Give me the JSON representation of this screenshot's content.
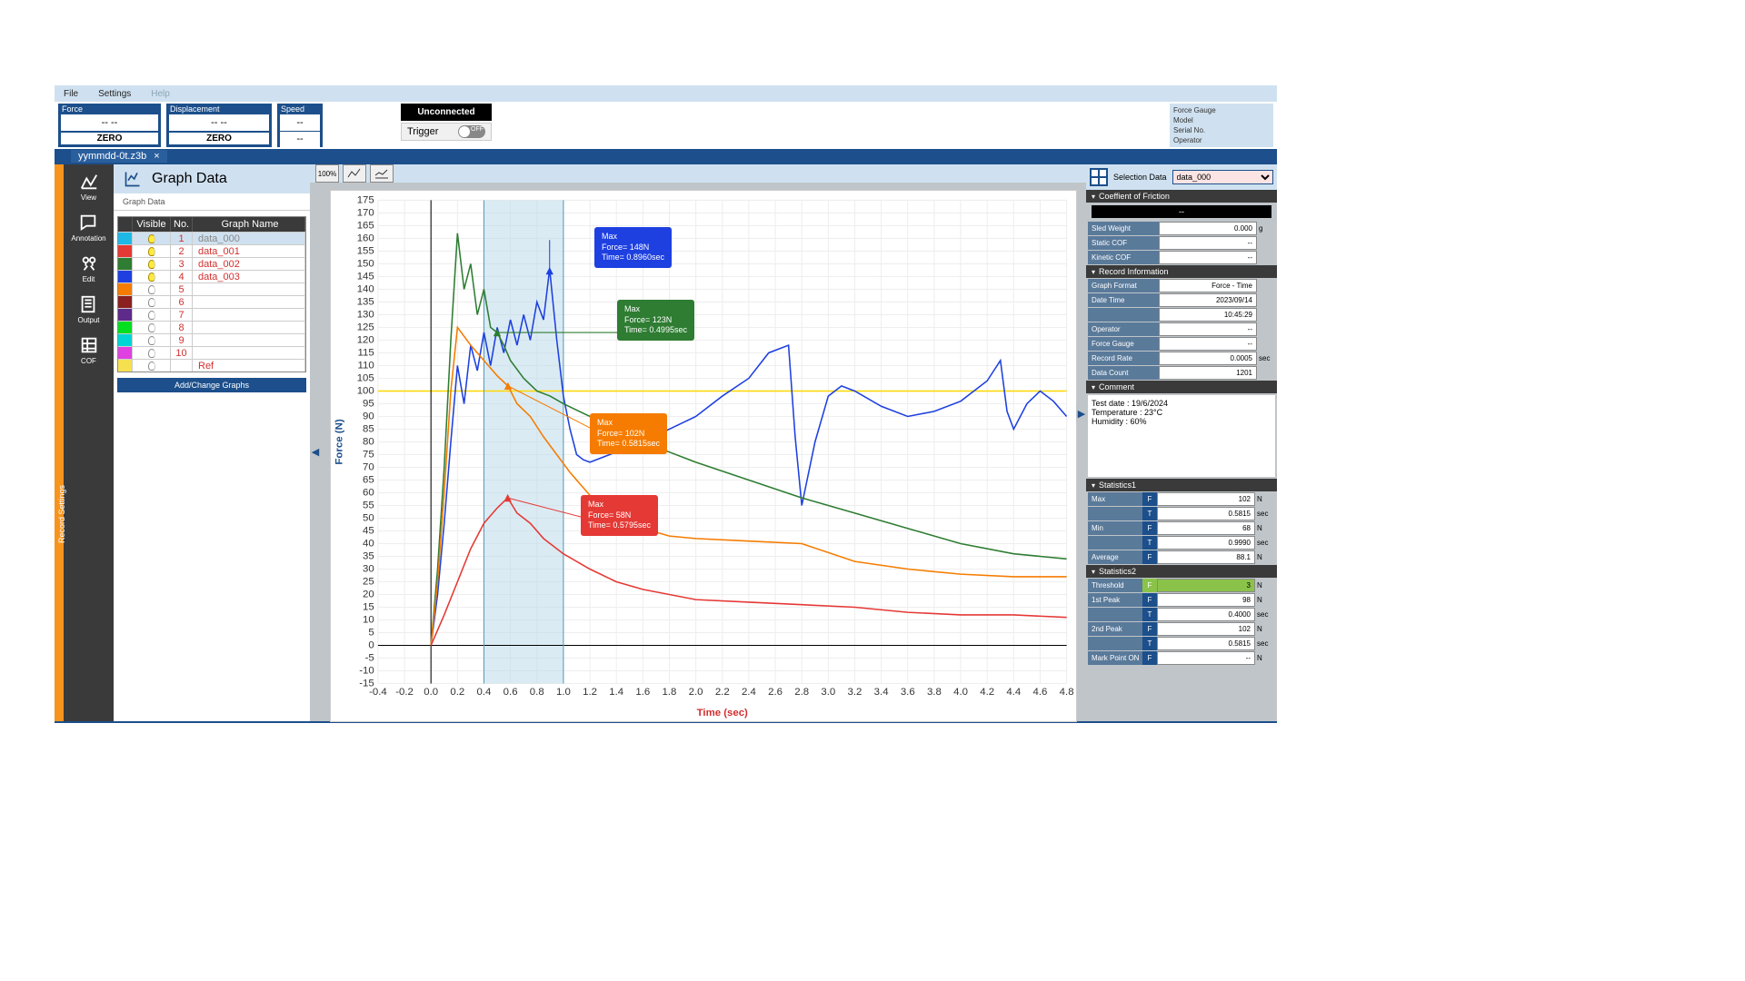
{
  "menu": {
    "file": "File",
    "settings": "Settings",
    "help": "Help"
  },
  "meters": {
    "force": {
      "title": "Force",
      "value": "-- --",
      "btn": "ZERO"
    },
    "disp": {
      "title": "Displacement",
      "value": "-- --",
      "btn": "ZERO"
    },
    "speed": {
      "title": "Speed",
      "value": "--",
      "value2": "--"
    }
  },
  "status": {
    "conn": "Unconnected",
    "trigger_label": "Trigger"
  },
  "device": {
    "a": "Force Gauge",
    "b": "Model",
    "c": "Serial No.",
    "d": "Operator"
  },
  "tab": {
    "name": "yymmdd-0t.z3b"
  },
  "orange_label": "Record Settings",
  "sidebar": [
    {
      "label": "View"
    },
    {
      "label": "Annotation"
    },
    {
      "label": "Edit"
    },
    {
      "label": "Output"
    },
    {
      "label": "COF"
    }
  ],
  "leftpanel": {
    "title": "Graph Data",
    "subtab": "Graph Data",
    "add": "Add/Change Graphs",
    "headers": {
      "vis": "Visible",
      "no": "No.",
      "name": "Graph Name"
    },
    "rows": [
      {
        "color": "#1EB8E6",
        "on": true,
        "no": "1",
        "name": "data_000",
        "sel": true
      },
      {
        "color": "#E53935",
        "on": true,
        "no": "2",
        "name": "data_001"
      },
      {
        "color": "#2E7D32",
        "on": true,
        "no": "3",
        "name": "data_002"
      },
      {
        "color": "#1E40E0",
        "on": true,
        "no": "4",
        "name": "data_003"
      },
      {
        "color": "#F57C00",
        "on": false,
        "no": "5",
        "name": ""
      },
      {
        "color": "#8B2020",
        "on": false,
        "no": "6",
        "name": ""
      },
      {
        "color": "#5E2B8A",
        "on": false,
        "no": "7",
        "name": ""
      },
      {
        "color": "#00E020",
        "on": false,
        "no": "8",
        "name": ""
      },
      {
        "color": "#00D5D5",
        "on": false,
        "no": "9",
        "name": ""
      },
      {
        "color": "#E040E0",
        "on": false,
        "no": "10",
        "name": ""
      },
      {
        "color": "#F5E050",
        "on": false,
        "no": "",
        "name": "Ref"
      }
    ]
  },
  "chart_data": {
    "type": "line",
    "title": "",
    "xlabel": "Time (sec)",
    "ylabel": "Force (N)",
    "xlim": [
      -0.4,
      4.8
    ],
    "ylim": [
      -15,
      175
    ],
    "xticks": [
      -0.4,
      -0.2,
      0.0,
      0.2,
      0.4,
      0.6,
      0.8,
      1.0,
      1.2,
      1.4,
      1.6,
      1.8,
      2.0,
      2.2,
      2.4,
      2.6,
      2.8,
      3.0,
      3.2,
      3.4,
      3.6,
      3.8,
      4.0,
      4.2,
      4.4,
      4.6,
      4.8
    ],
    "yticks": [
      -15,
      -10,
      -5,
      0,
      5,
      10,
      15,
      20,
      25,
      30,
      35,
      40,
      45,
      50,
      55,
      60,
      65,
      70,
      75,
      80,
      85,
      90,
      95,
      100,
      105,
      110,
      115,
      120,
      125,
      130,
      135,
      140,
      145,
      150,
      155,
      160,
      165,
      170,
      175
    ],
    "highlight_region": [
      0.4,
      1.0
    ],
    "reference_line_y": 100,
    "annotations": [
      {
        "series": "blue",
        "label": "Max",
        "force": "148N",
        "time": "0.8960sec"
      },
      {
        "series": "green",
        "label": "Max",
        "force": "123N",
        "time": "0.4995sec"
      },
      {
        "series": "orange",
        "label": "Max",
        "force": "102N",
        "time": "0.5815sec"
      },
      {
        "series": "red",
        "label": "Max",
        "force": "58N",
        "time": "0.5795sec"
      }
    ],
    "series": [
      {
        "name": "data_003",
        "color": "#1E40E0",
        "x": [
          0,
          0.05,
          0.1,
          0.15,
          0.2,
          0.25,
          0.3,
          0.35,
          0.4,
          0.45,
          0.5,
          0.55,
          0.6,
          0.65,
          0.7,
          0.75,
          0.8,
          0.85,
          0.896,
          0.95,
          1.0,
          1.05,
          1.1,
          1.15,
          1.2,
          1.3,
          1.4,
          1.6,
          1.8,
          2.0,
          2.2,
          2.4,
          2.55,
          2.7,
          2.75,
          2.8,
          2.9,
          3.0,
          3.1,
          3.2,
          3.4,
          3.6,
          3.8,
          4.0,
          4.2,
          4.3,
          4.35,
          4.4,
          4.5,
          4.6,
          4.7,
          4.8
        ],
        "y": [
          0,
          20,
          48,
          80,
          110,
          95,
          118,
          108,
          123,
          110,
          125,
          115,
          128,
          118,
          130,
          120,
          135,
          128,
          148,
          120,
          98,
          85,
          75,
          73,
          72,
          74,
          76,
          80,
          85,
          90,
          98,
          105,
          115,
          118,
          82,
          55,
          80,
          98,
          102,
          100,
          94,
          90,
          92,
          96,
          104,
          112,
          92,
          85,
          95,
          100,
          96,
          90
        ]
      },
      {
        "name": "data_002",
        "color": "#2E7D32",
        "x": [
          0,
          0.05,
          0.1,
          0.15,
          0.2,
          0.25,
          0.3,
          0.35,
          0.4,
          0.45,
          0.4995,
          0.55,
          0.6,
          0.7,
          0.8,
          0.9,
          1.0,
          1.2,
          1.4,
          1.6,
          1.8,
          2.0,
          2.4,
          2.8,
          3.2,
          3.6,
          4.0,
          4.4,
          4.8
        ],
        "y": [
          0,
          30,
          70,
          120,
          162,
          140,
          150,
          130,
          140,
          125,
          123,
          118,
          112,
          105,
          100,
          98,
          95,
          90,
          85,
          80,
          76,
          72,
          65,
          58,
          52,
          46,
          40,
          36,
          34
        ]
      },
      {
        "name": "data_000",
        "color": "#F57C00",
        "x": [
          0,
          0.05,
          0.1,
          0.15,
          0.2,
          0.3,
          0.4,
          0.5,
          0.5815,
          0.65,
          0.75,
          0.85,
          0.95,
          1.05,
          1.15,
          1.25,
          1.4,
          1.6,
          1.8,
          2.0,
          2.4,
          2.8,
          3.2,
          3.6,
          4.0,
          4.4,
          4.8
        ],
        "y": [
          0,
          25,
          60,
          100,
          125,
          118,
          112,
          106,
          102,
          95,
          90,
          82,
          75,
          68,
          62,
          56,
          50,
          46,
          43,
          42,
          41,
          40,
          33,
          30,
          28,
          27,
          27
        ]
      },
      {
        "name": "data_001",
        "color": "#E53935",
        "x": [
          0,
          0.1,
          0.2,
          0.3,
          0.4,
          0.5,
          0.5795,
          0.65,
          0.75,
          0.85,
          1.0,
          1.2,
          1.4,
          1.6,
          2.0,
          2.4,
          2.8,
          3.2,
          3.6,
          4.0,
          4.4,
          4.8
        ],
        "y": [
          0,
          12,
          25,
          38,
          48,
          54,
          58,
          52,
          48,
          42,
          36,
          30,
          25,
          22,
          18,
          17,
          16,
          15,
          13,
          12,
          12,
          11
        ]
      }
    ]
  },
  "rpanel": {
    "sel_label": "Selection Data",
    "sel_value": "data_000",
    "cof_hdr": "Coeffient of Friction",
    "cof_top": "--",
    "cof": [
      {
        "k": "Sled Weight",
        "v": "0.000",
        "u": "g"
      },
      {
        "k": "Static COF",
        "v": "--",
        "u": ""
      },
      {
        "k": "Kinetic COF",
        "v": "--",
        "u": ""
      }
    ],
    "rec_hdr": "Record Information",
    "rec": [
      {
        "k": "Graph Format",
        "v": "Force - Time"
      },
      {
        "k": "Date Time",
        "v": "2023/09/14"
      },
      {
        "k": "",
        "v": "10:45:29"
      },
      {
        "k": "Operator",
        "v": "--"
      },
      {
        "k": "Force Gauge",
        "v": "--"
      },
      {
        "k": "Record Rate",
        "v": "0.0005",
        "u": "sec"
      },
      {
        "k": "Data Count",
        "v": "1201"
      }
    ],
    "comment_hdr": "Comment",
    "comment": [
      "Test date : 19/6/2024",
      "Temperature : 23°C",
      "Humidity : 60%"
    ],
    "stats1_hdr": "Statistics1",
    "stats1": [
      {
        "k": "Max",
        "ft": "F",
        "v": "102",
        "u": "N"
      },
      {
        "k": "",
        "ft": "T",
        "v": "0.5815",
        "u": "sec"
      },
      {
        "k": "Min",
        "ft": "F",
        "v": "68",
        "u": "N"
      },
      {
        "k": "",
        "ft": "T",
        "v": "0.9990",
        "u": "sec"
      },
      {
        "k": "Average",
        "ft": "F",
        "v": "88.1",
        "u": "N"
      }
    ],
    "stats2_hdr": "Statistics2",
    "stats2": [
      {
        "k": "Threshold",
        "ft": "F",
        "v": "3",
        "u": "N",
        "green": true
      },
      {
        "k": "1st Peak",
        "ft": "F",
        "v": "98",
        "u": "N"
      },
      {
        "k": "",
        "ft": "T",
        "v": "0.4000",
        "u": "sec"
      },
      {
        "k": "2nd Peak",
        "ft": "F",
        "v": "102",
        "u": "N"
      },
      {
        "k": "",
        "ft": "T",
        "v": "0.5815",
        "u": "sec"
      },
      {
        "k": "Mark Point ON",
        "ft": "F",
        "v": "--",
        "u": "N"
      }
    ]
  }
}
